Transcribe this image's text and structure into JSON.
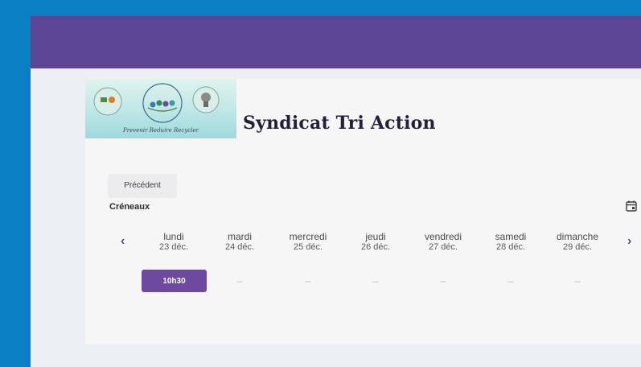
{
  "org": {
    "title": "Syndicat Tri Action",
    "logo_caption": "Prevenir Reduire Recycler"
  },
  "navigation": {
    "previous_label": "Précédent"
  },
  "schedule": {
    "heading": "Créneaux",
    "prev_arrow": "‹",
    "next_arrow": "›",
    "days": [
      {
        "name": "lundi",
        "date": "23 déc."
      },
      {
        "name": "mardi",
        "date": "24 déc."
      },
      {
        "name": "mercredi",
        "date": "25 déc."
      },
      {
        "name": "jeudi",
        "date": "26 déc."
      },
      {
        "name": "vendredi",
        "date": "27 déc."
      },
      {
        "name": "samedi",
        "date": "28 déc."
      },
      {
        "name": "dimanche",
        "date": "29 déc."
      }
    ],
    "slots": {
      "monday": "10h30",
      "empty": "–"
    }
  },
  "colors": {
    "page_bg": "#0a7fc4",
    "topbar": "#5c4595",
    "accent": "#6d4a9f"
  }
}
